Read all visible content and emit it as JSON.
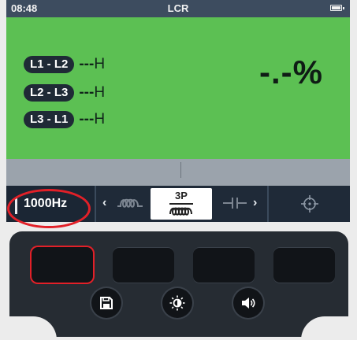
{
  "status_bar": {
    "time": "08:48",
    "title": "LCR",
    "battery_icon": "battery-icon"
  },
  "measurement": {
    "rows": [
      {
        "label": "L1 - L2",
        "value": "---",
        "unit": "H"
      },
      {
        "label": "L2 - L3",
        "value": "---",
        "unit": "H"
      },
      {
        "label": "L3 - L1",
        "value": "---",
        "unit": "H"
      }
    ],
    "percent": "-.-%"
  },
  "soft_keys": {
    "frequency": "1000Hz",
    "mode_selected": "3P",
    "mode_icons": [
      "inductor-coil-icon",
      "inductor-3p-icon",
      "capacitor-icon"
    ],
    "target_icon": "crosshair-icon"
  },
  "hardware_keys": {
    "function_keys": [
      "f1-key",
      "f2-key",
      "f3-key",
      "f4-key"
    ],
    "round_keys": [
      "save-icon",
      "brightness-icon",
      "volume-icon"
    ]
  },
  "colors": {
    "display_green": "#5cc053",
    "highlight_red": "#e22028",
    "dark_panel": "#1f2a38"
  }
}
